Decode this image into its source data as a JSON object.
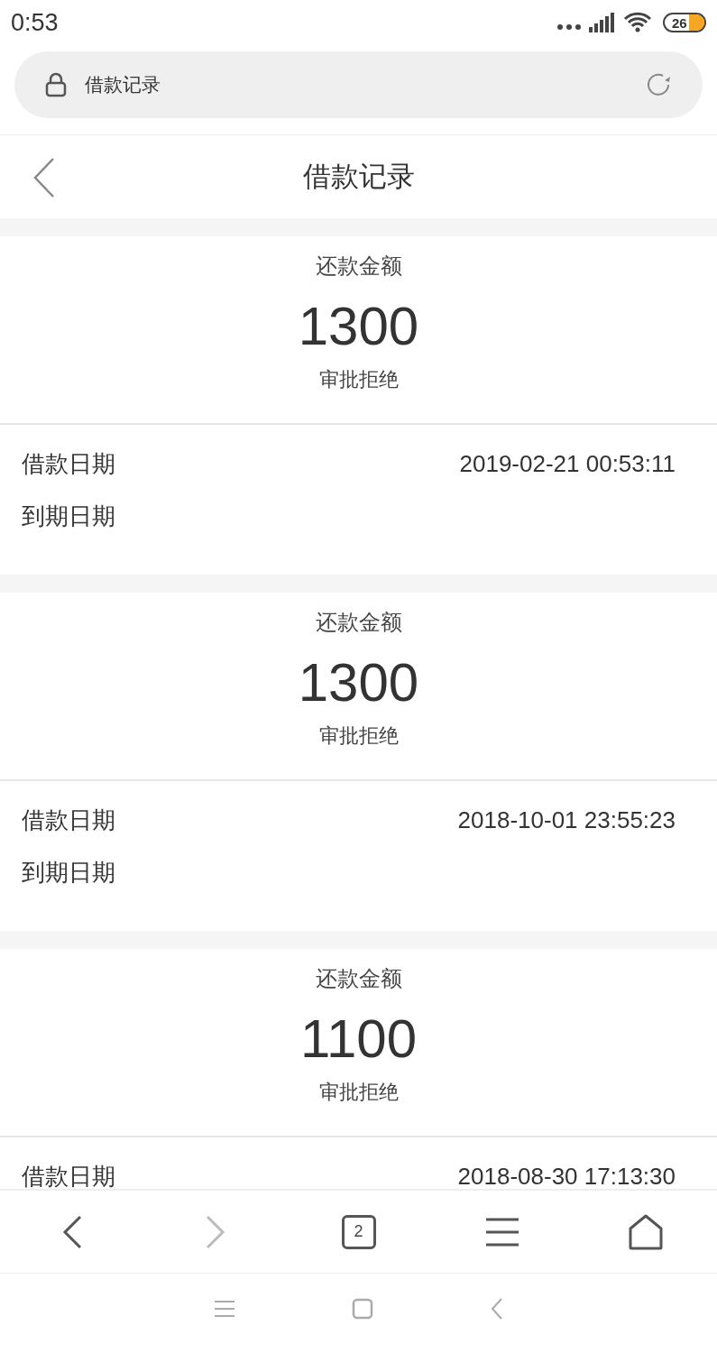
{
  "status_bar": {
    "time": "0:53",
    "battery": "26"
  },
  "address_bar": {
    "title": "借款记录"
  },
  "header": {
    "title": "借款记录"
  },
  "records": [
    {
      "amount_label": "还款金额",
      "amount": "1300",
      "status": "审批拒绝",
      "loan_date_label": "借款日期",
      "loan_date": "2019-02-21 00:53:11",
      "due_date_label": "到期日期"
    },
    {
      "amount_label": "还款金额",
      "amount": "1300",
      "status": "审批拒绝",
      "loan_date_label": "借款日期",
      "loan_date": "2018-10-01 23:55:23",
      "due_date_label": "到期日期"
    },
    {
      "amount_label": "还款金额",
      "amount": "1100",
      "status": "审批拒绝",
      "loan_date_label": "借款日期",
      "loan_date": "2018-08-30 17:13:30"
    }
  ],
  "browser_toolbar": {
    "back_disabled": false,
    "forward_disabled": true,
    "tab_count": "2"
  }
}
